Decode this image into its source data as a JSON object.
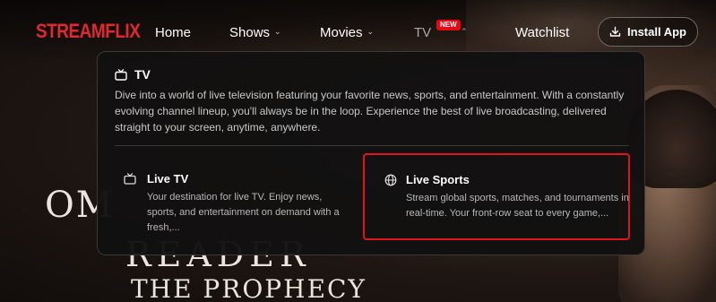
{
  "brand": {
    "logo_text": "STREAMFLIX",
    "accent": "#e0282e"
  },
  "nav": {
    "items": [
      {
        "label": "Home",
        "has_chevron": false
      },
      {
        "label": "Shows",
        "has_chevron": true
      },
      {
        "label": "Movies",
        "has_chevron": true
      },
      {
        "label": "TV",
        "has_chevron": true,
        "badge": "NEW",
        "expanded": true
      },
      {
        "label": "Watchlist",
        "has_chevron": false
      }
    ],
    "install_button": {
      "label": "Install App",
      "icon": "download-icon"
    }
  },
  "hero": {
    "title_line1": "OM",
    "title_line2": "READER",
    "title_line3": "THE PROPHECY"
  },
  "dropdown": {
    "header": {
      "icon": "tv-icon",
      "title": "TV"
    },
    "description": "Dive into a world of live television featuring your favorite news, sports, and entertainment. With a constantly evolving channel lineup, you'll always be in the loop. Experience the best of live broadcasting, delivered straight to your screen, anytime, anywhere.",
    "cards": [
      {
        "icon": "tv-icon",
        "title": "Live TV",
        "description": "Your destination for live TV. Enjoy news, sports, and entertainment on demand with a fresh,..."
      },
      {
        "icon": "globe-icon",
        "title": "Live Sports",
        "description": "Stream global sports, matches, and tournaments in real-time. Your front-row seat to every game,...",
        "highlighted": true,
        "highlight_color": "#e0141b"
      }
    ]
  }
}
